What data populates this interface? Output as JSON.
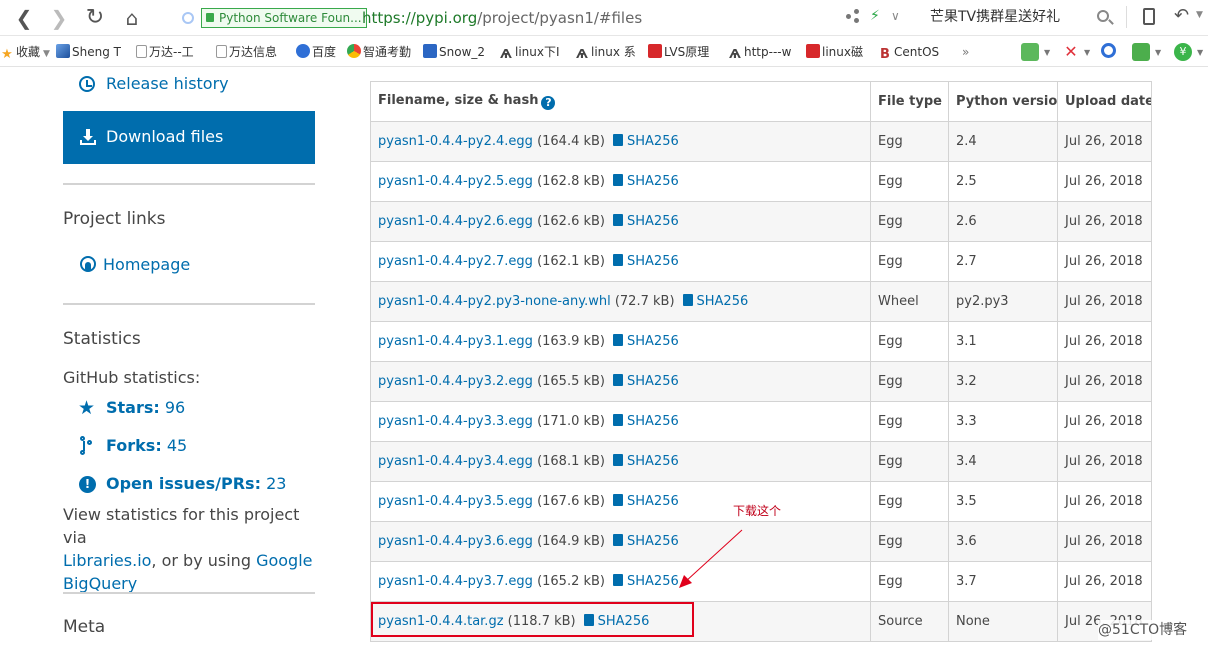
{
  "browser": {
    "secure_label": "Python Software Foun...",
    "url_host": "https://pypi.org",
    "url_path": "/project/pyasn1/#files",
    "promo_text": "芒果TV携群星送好礼"
  },
  "bookmarks": [
    {
      "label": "收藏",
      "icon": "star-icon"
    },
    {
      "label": "Sheng T",
      "icon": "photo-icon"
    },
    {
      "label": "万达--工",
      "icon": "document-icon"
    },
    {
      "label": "万达信息",
      "icon": "document-icon"
    },
    {
      "label": "百度",
      "icon": "baidu-paw-icon"
    },
    {
      "label": "智通考勤",
      "icon": "chrome-icon"
    },
    {
      "label": "Snow_2",
      "icon": "site-icon"
    },
    {
      "label": "linux下I",
      "icon": "v-icon"
    },
    {
      "label": "linux 系",
      "icon": "v-icon"
    },
    {
      "label": "LVS原理",
      "icon": "csdn-icon"
    },
    {
      "label": "http---w",
      "icon": "v-icon"
    },
    {
      "label": "linux磁",
      "icon": "csdn-icon"
    },
    {
      "label": "CentOS",
      "icon": "b-icon"
    },
    {
      "label": "»",
      "icon": ""
    }
  ],
  "sidebar": {
    "release_history": "Release history",
    "download_files": "Download files",
    "project_links_heading": "Project links",
    "homepage": "Homepage",
    "statistics_heading": "Statistics",
    "github_stats_label": "GitHub statistics:",
    "stars_label": "Stars:",
    "stars_value": "96",
    "forks_label": "Forks:",
    "forks_value": "45",
    "issues_label": "Open issues/PRs:",
    "issues_value": "23",
    "view_stats_text_1": "View statistics for this project via",
    "libraries_link": "Libraries.io",
    "view_stats_text_2": ", or by using",
    "google_link": "Google",
    "bigquery_link": "BigQuery",
    "meta_heading": "Meta"
  },
  "files_table": {
    "headers": [
      "Filename, size & hash",
      "File type",
      "Python version",
      "Upload date"
    ],
    "hash_label": "SHA256",
    "rows": [
      {
        "file": "pyasn1-0.4.4-py2.4.egg",
        "size": "(164.4 kB)",
        "type": "Egg",
        "python": "2.4",
        "date": "Jul 26, 2018"
      },
      {
        "file": "pyasn1-0.4.4-py2.5.egg",
        "size": "(162.8 kB)",
        "type": "Egg",
        "python": "2.5",
        "date": "Jul 26, 2018"
      },
      {
        "file": "pyasn1-0.4.4-py2.6.egg",
        "size": "(162.6 kB)",
        "type": "Egg",
        "python": "2.6",
        "date": "Jul 26, 2018"
      },
      {
        "file": "pyasn1-0.4.4-py2.7.egg",
        "size": "(162.1 kB)",
        "type": "Egg",
        "python": "2.7",
        "date": "Jul 26, 2018"
      },
      {
        "file": "pyasn1-0.4.4-py2.py3-none-any.whl",
        "size": "(72.7 kB)",
        "type": "Wheel",
        "python": "py2.py3",
        "date": "Jul 26, 2018"
      },
      {
        "file": "pyasn1-0.4.4-py3.1.egg",
        "size": "(163.9 kB)",
        "type": "Egg",
        "python": "3.1",
        "date": "Jul 26, 2018"
      },
      {
        "file": "pyasn1-0.4.4-py3.2.egg",
        "size": "(165.5 kB)",
        "type": "Egg",
        "python": "3.2",
        "date": "Jul 26, 2018"
      },
      {
        "file": "pyasn1-0.4.4-py3.3.egg",
        "size": "(171.0 kB)",
        "type": "Egg",
        "python": "3.3",
        "date": "Jul 26, 2018"
      },
      {
        "file": "pyasn1-0.4.4-py3.4.egg",
        "size": "(168.1 kB)",
        "type": "Egg",
        "python": "3.4",
        "date": "Jul 26, 2018"
      },
      {
        "file": "pyasn1-0.4.4-py3.5.egg",
        "size": "(167.6 kB)",
        "type": "Egg",
        "python": "3.5",
        "date": "Jul 26, 2018"
      },
      {
        "file": "pyasn1-0.4.4-py3.6.egg",
        "size": "(164.9 kB)",
        "type": "Egg",
        "python": "3.6",
        "date": "Jul 26, 2018"
      },
      {
        "file": "pyasn1-0.4.4-py3.7.egg",
        "size": "(165.2 kB)",
        "type": "Egg",
        "python": "3.7",
        "date": "Jul 26, 2018"
      },
      {
        "file": "pyasn1-0.4.4.tar.gz",
        "size": "(118.7 kB)",
        "type": "Source",
        "python": "None",
        "date": "Jul 26, 2018"
      }
    ]
  },
  "annotation": {
    "note": "下载这个",
    "watermark": "@51CTO博客",
    "color": "#e0001b"
  },
  "colors": {
    "link": "#006dad",
    "primary_button": "#006dad",
    "text": "#464646"
  }
}
